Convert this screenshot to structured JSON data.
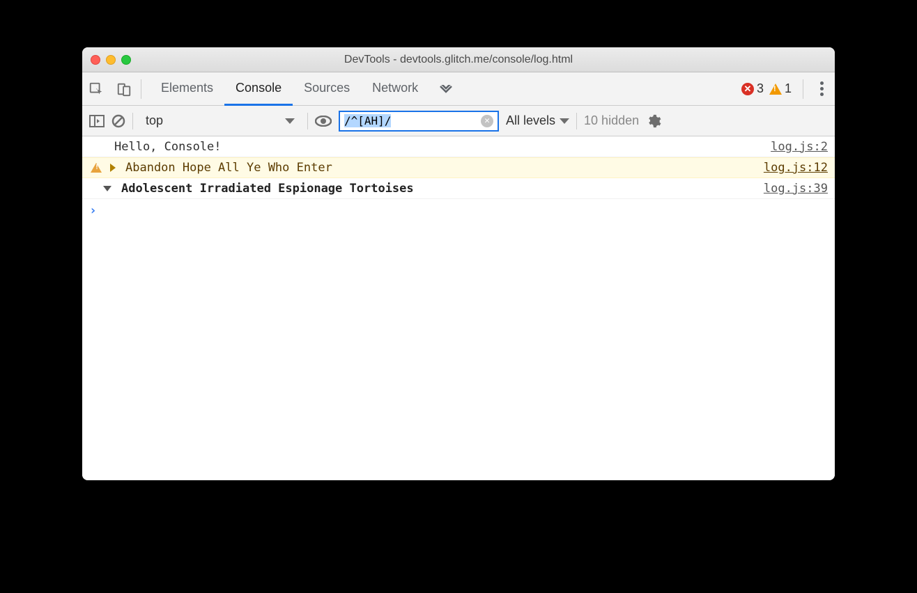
{
  "window": {
    "title": "DevTools - devtools.glitch.me/console/log.html"
  },
  "tabs": {
    "elements": "Elements",
    "console": "Console",
    "sources": "Sources",
    "network": "Network"
  },
  "badges": {
    "errors": "3",
    "warnings": "1"
  },
  "toolbar": {
    "context": "top",
    "filter_value": "/^[AH]/",
    "levels": "All levels",
    "hidden": "10 hidden"
  },
  "rows": [
    {
      "msg": "Hello, Console!",
      "src": "log.js:2"
    },
    {
      "msg": "Abandon Hope All Ye Who Enter",
      "src": "log.js:12"
    },
    {
      "msg": "Adolescent Irradiated Espionage Tortoises",
      "src": "log.js:39"
    }
  ],
  "prompt": "›"
}
